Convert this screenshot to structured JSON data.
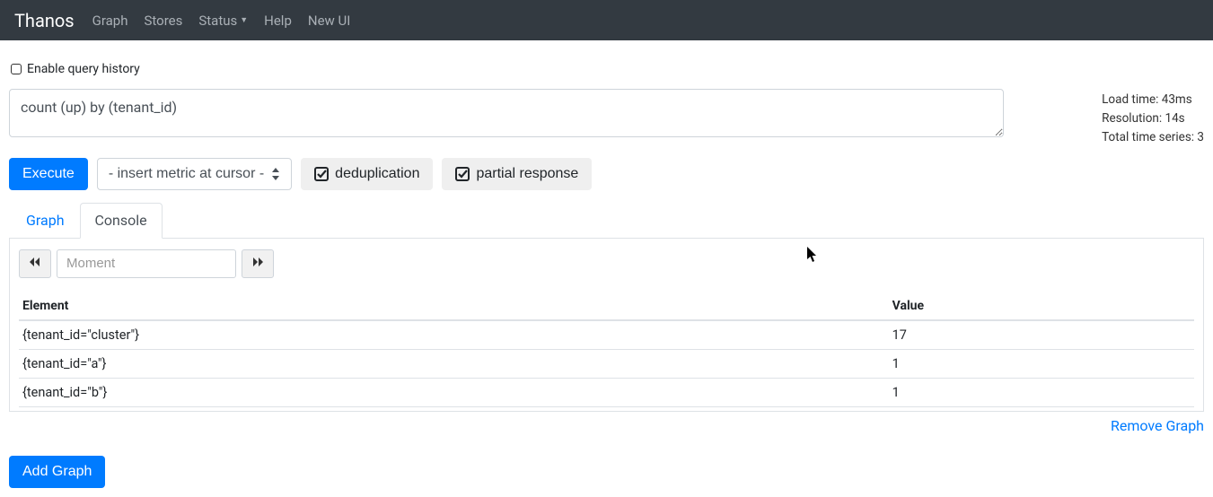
{
  "nav": {
    "brand": "Thanos",
    "items": [
      "Graph",
      "Stores",
      "Status",
      "Help",
      "New UI"
    ]
  },
  "enable_history_label": "Enable query history",
  "query": {
    "value": "count (up) by (tenant_id)"
  },
  "stats": {
    "load_time": "Load time: 43ms",
    "resolution": "Resolution: 14s",
    "total_series": "Total time series: 3"
  },
  "controls": {
    "execute": "Execute",
    "metric_select": "- insert metric at cursor -",
    "dedup": "deduplication",
    "partial": "partial response"
  },
  "tabs": {
    "graph": "Graph",
    "console": "Console"
  },
  "moment": {
    "placeholder": "Moment"
  },
  "table": {
    "headers": {
      "element": "Element",
      "value": "Value"
    },
    "rows": [
      {
        "element": "{tenant_id=\"cluster\"}",
        "value": "17"
      },
      {
        "element": "{tenant_id=\"a\"}",
        "value": "1"
      },
      {
        "element": "{tenant_id=\"b\"}",
        "value": "1"
      }
    ]
  },
  "remove_graph": "Remove Graph",
  "add_graph": "Add Graph"
}
